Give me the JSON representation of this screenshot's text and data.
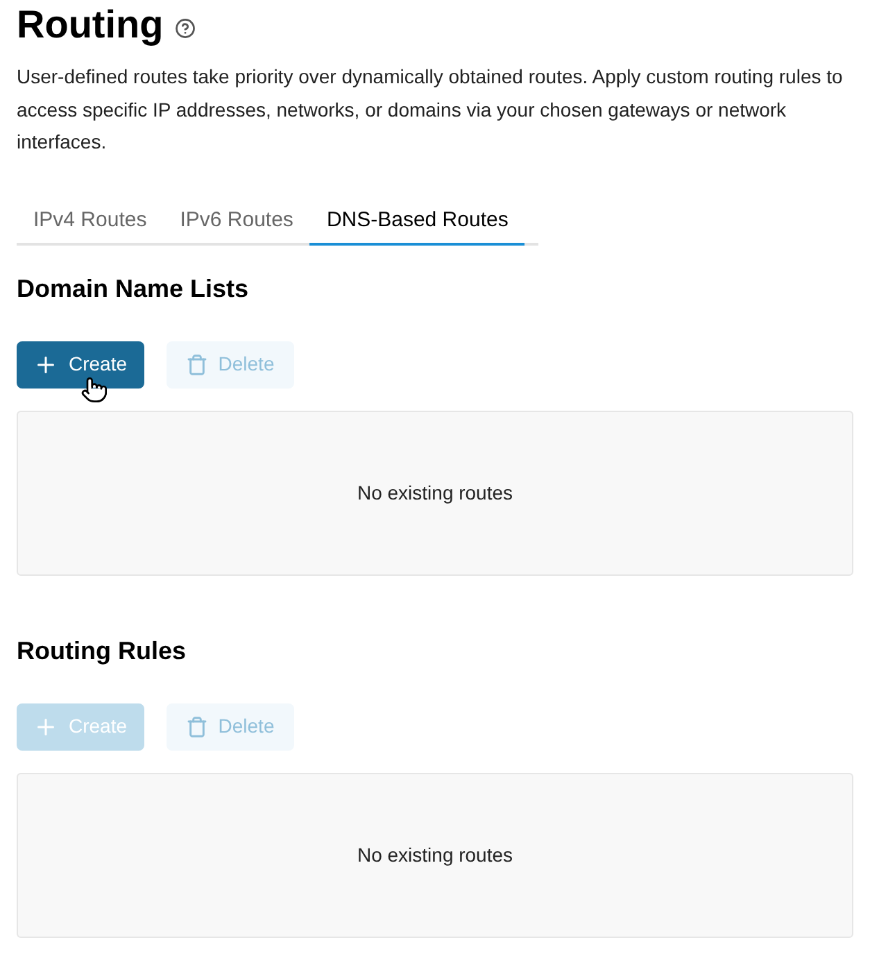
{
  "page": {
    "title": "Routing",
    "description": "User-defined routes take priority over dynamically obtained routes. Apply custom routing rules to access specific IP addresses, networks, or domains via your chosen gateways or network interfaces."
  },
  "tabs": [
    {
      "label": "IPv4 Routes",
      "selected": false
    },
    {
      "label": "IPv6 Routes",
      "selected": false
    },
    {
      "label": "DNS-Based Routes",
      "selected": true
    }
  ],
  "sections": [
    {
      "heading": "Domain Name Lists",
      "buttons": [
        {
          "kind": "create",
          "label": "Create",
          "disabled": false,
          "pointer_over": true
        },
        {
          "kind": "delete",
          "label": "Delete",
          "disabled": true,
          "pointer_over": false
        }
      ],
      "empty_text": "No existing routes"
    },
    {
      "heading": "Routing Rules",
      "buttons": [
        {
          "kind": "create",
          "label": "Create",
          "disabled": true,
          "pointer_over": false
        },
        {
          "kind": "delete",
          "label": "Delete",
          "disabled": true,
          "pointer_over": false
        }
      ],
      "empty_text": "No existing routes"
    }
  ]
}
